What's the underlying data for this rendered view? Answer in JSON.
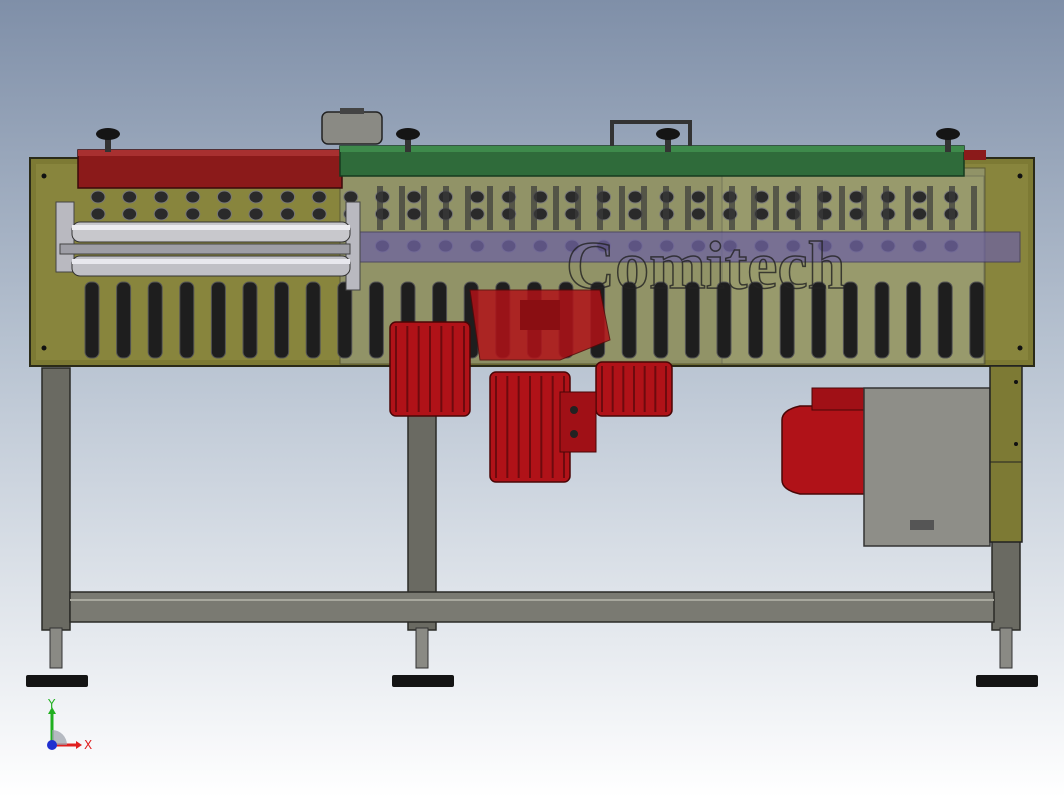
{
  "viewport": {
    "name": "cad-model-viewport"
  },
  "model": {
    "brand_text": "Comitech"
  },
  "triad": {
    "x_label": "X",
    "y_label": "Y"
  },
  "colors": {
    "background_top": "#7f8fa8",
    "background_bottom": "#ffffff",
    "frame_olive": "#7d7a34",
    "frame_olive_light": "#a3a050",
    "roller_dark": "#1e1e1e",
    "cover_red": "#8b1a1a",
    "cover_green": "#2f6b3a",
    "motor_red": "#b01218",
    "motor_red_dark": "#6e0a0e",
    "leg_grey": "#6a6a62",
    "leg_grey_light": "#9a9a90",
    "plate_grey": "#8e8e88",
    "shaft_purple": "#6e63a0",
    "triad_x": "#e02020",
    "triad_y": "#20b020",
    "triad_z": "#2030d0"
  }
}
